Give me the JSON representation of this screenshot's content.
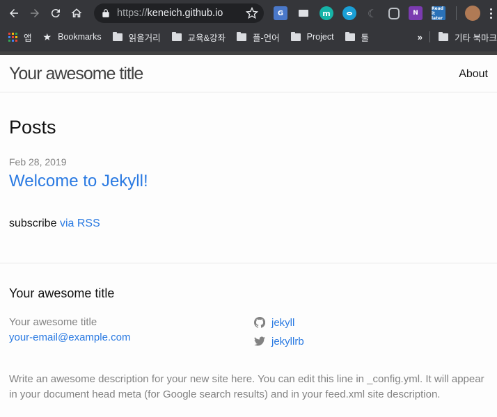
{
  "browser": {
    "url_scheme": "https://",
    "url_host": "keneich.github.io",
    "bookmarks_bar": {
      "apps_label": "앱",
      "items": [
        "Bookmarks",
        "읽을거리",
        "교육&강좌",
        "플-언어",
        "Project",
        "툴"
      ],
      "more_label": "»",
      "other_label": "기타 북마크"
    },
    "extensions": {
      "mercury_letter": "m",
      "onenote_letter": "N",
      "pocket_label": "Read it later"
    },
    "colors": {
      "chrome_bg": "#35363a",
      "omnibox_bg": "#202124"
    }
  },
  "site": {
    "title": "Your awesome title",
    "nav_about": "About",
    "colors": {
      "link": "#2a7ae2",
      "text": "#111111",
      "muted": "#828282",
      "header_border": "#424242"
    }
  },
  "main": {
    "heading": "Posts",
    "posts": [
      {
        "date": "Feb 28, 2019",
        "title": "Welcome to Jekyll!"
      }
    ],
    "rss_prefix": "subscribe",
    "rss_link": "via RSS"
  },
  "footer": {
    "heading": "Your awesome title",
    "name": "Your awesome title",
    "email": "your-email@example.com",
    "github": "jekyll",
    "twitter": "jekyllrb",
    "description": "Write an awesome description for your new site here. You can edit this line in _config.yml. It will appear in your document head meta (for Google search results) and in your feed.xml site description."
  }
}
